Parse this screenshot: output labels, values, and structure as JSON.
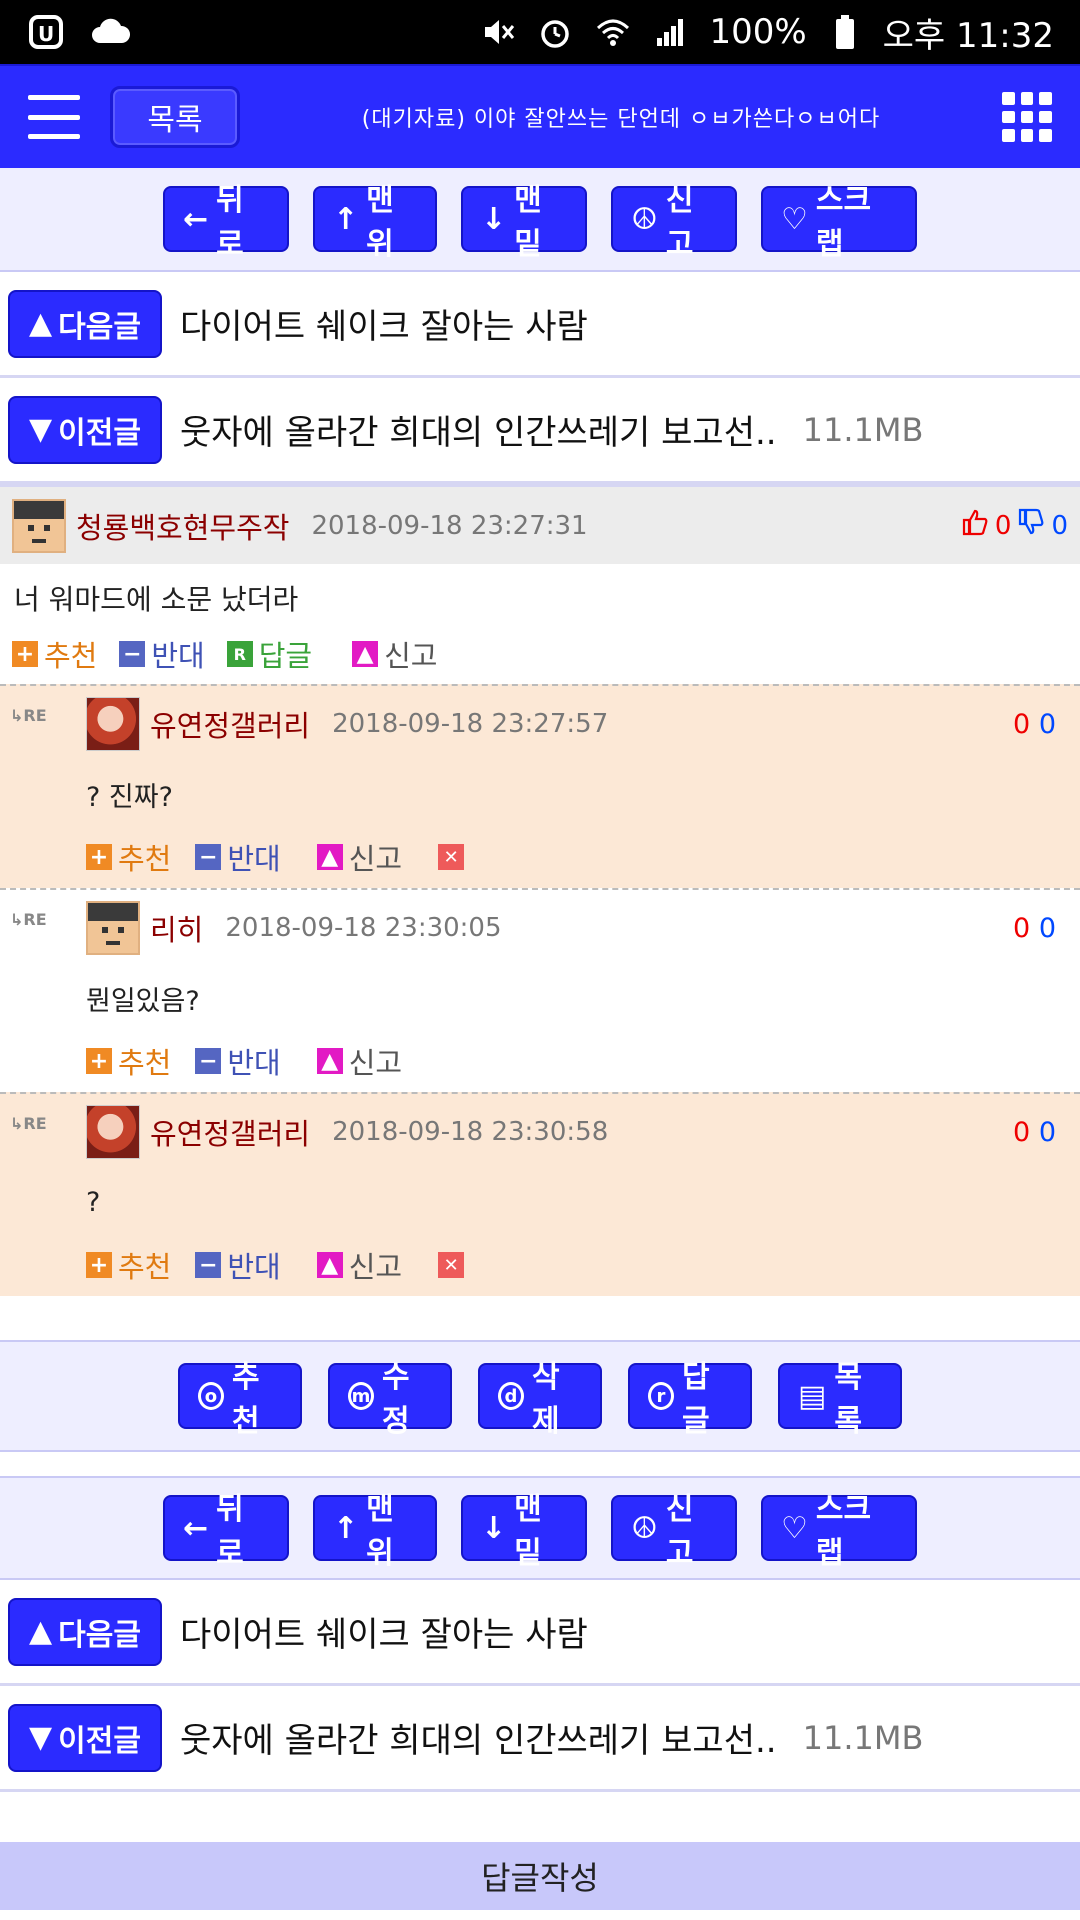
{
  "status": {
    "battery": "100%",
    "time": "오후 11:32"
  },
  "appbar": {
    "list_label": "목록",
    "title": "(대기자료) 이야 잘안쓰는 단언데 ㅇㅂ가쓴다ㅇㅂ어다"
  },
  "toolbar": {
    "back": "뒤로",
    "top": "맨위",
    "bottom": "맨밑",
    "report": "신고",
    "scrap": "스크랩"
  },
  "nav": {
    "next_label": "다음글",
    "next_title": "다이어트 쉐이크 잘아는 사람",
    "prev_label": "이전글",
    "prev_title": "웃자에 올라간 희대의 인간쓰레기 보고선..",
    "prev_size": "11.1MB"
  },
  "comment": {
    "nick": "청룡백호현무주작",
    "date": "2018-09-18 23:27:31",
    "up": "0",
    "down": "0",
    "body": "너 워마드에 소문 났더라",
    "actions": {
      "recommend": "추천",
      "oppose": "반대",
      "reply": "답글",
      "report": "신고"
    }
  },
  "replies": [
    {
      "nick": "유연정갤러리",
      "date": "2018-09-18 23:27:57",
      "up": "0",
      "down": "0",
      "body": "? 진짜?"
    },
    {
      "nick": "리히",
      "date": "2018-09-18 23:30:05",
      "up": "0",
      "down": "0",
      "body": "뭔일있음?"
    },
    {
      "nick": "유연정갤러리",
      "date": "2018-09-18 23:30:58",
      "up": "0",
      "down": "0",
      "body": "?"
    }
  ],
  "re_tag": "RE",
  "reply_actions": {
    "recommend": "추천",
    "oppose": "반대",
    "report": "신고"
  },
  "bottombar": {
    "recommend": "추천",
    "edit": "수정",
    "delete": "삭제",
    "reply": "답글",
    "list": "목록"
  },
  "write_reply": "답글작성"
}
